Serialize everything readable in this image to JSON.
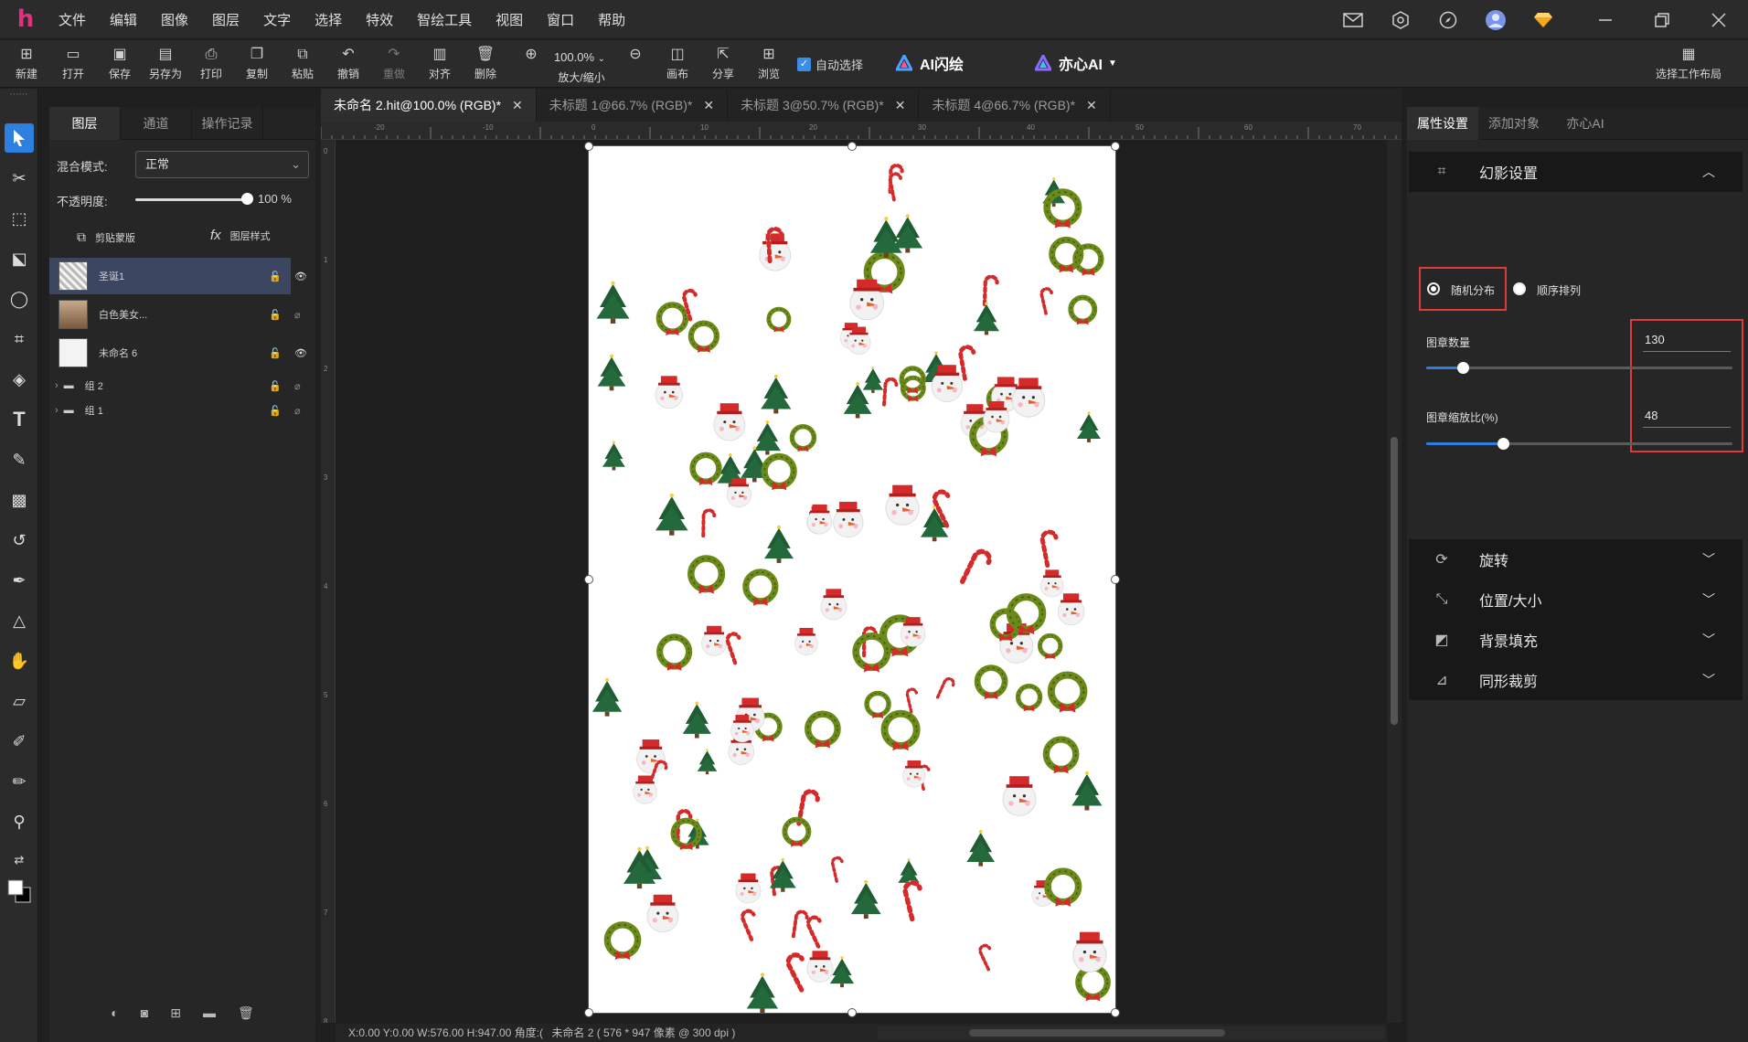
{
  "menu": [
    "文件",
    "编辑",
    "图像",
    "图层",
    "文字",
    "选择",
    "特效",
    "智绘工具",
    "视图",
    "窗口",
    "帮助"
  ],
  "toolbar": {
    "new": "新建",
    "open": "打开",
    "save": "保存",
    "save_as": "另存为",
    "print": "打印",
    "copy": "复制",
    "paste": "粘贴",
    "undo": "撤销",
    "redo": "重做",
    "align": "对齐",
    "delete": "删除",
    "zoom_value": "100.0%",
    "zoom_label": "放大/缩小",
    "canvas": "画布",
    "share": "分享",
    "browse": "浏览",
    "auto_select": "自动选择",
    "ai_flash": "AI闪绘",
    "yixin_ai": "亦心AI",
    "workspace_layout": "选择工作布局"
  },
  "layer_panel": {
    "tabs": [
      "图层",
      "通道",
      "操作记录"
    ],
    "blend_label": "混合模式:",
    "blend_value": "正常",
    "opacity_label": "不透明度:",
    "opacity_value": "100",
    "opacity_unit": "%",
    "opacity_level": 1.0,
    "clip_mask": "剪贴蒙版",
    "layer_style": "图层样式",
    "layers": [
      {
        "name": "圣诞1",
        "selected": true
      },
      {
        "name": "白色美女...",
        "selected": false
      },
      {
        "name": "未命名 6",
        "selected": false
      }
    ],
    "groups": [
      "组 2",
      "组 1"
    ]
  },
  "doc_tabs": [
    {
      "label": "未命名 2.hit@100.0% (RGB)*",
      "active": true
    },
    {
      "label": "未标题 1@66.7% (RGB)*",
      "active": false
    },
    {
      "label": "未标题 3@50.7% (RGB)*",
      "active": false
    },
    {
      "label": "未标题 4@66.7% (RGB)*",
      "active": false
    }
  ],
  "ruler_top": [
    "-20",
    "-10",
    "0",
    "10",
    "20",
    "30",
    "40",
    "50",
    "60",
    "70"
  ],
  "ruler_left": [
    "0",
    "1",
    "2",
    "3",
    "4",
    "5",
    "6",
    "7",
    "8"
  ],
  "status": {
    "coords": "X:0.00 Y:0.00 W:576.00 H:947.00 角度:(",
    "doc_info": "未命名 2 ( 576 * 947 像素 @ 300 dpi )"
  },
  "right_panel": {
    "tabs": [
      "属性设置",
      "添加对象",
      "亦心AI"
    ],
    "phantom_title": "幻影设置",
    "random_label": "随机分布",
    "sequential_label": "顺序排列",
    "count_label": "图章数量",
    "count_value": "130",
    "count_level": 0.12,
    "scale_label": "图章缩放比(%)",
    "scale_value": "48",
    "scale_level": 0.25,
    "sections": [
      "旋转",
      "位置/大小",
      "背景填充",
      "同形裁剪"
    ]
  },
  "colors": {
    "accent": "#2d7fe0",
    "highlight_box": "#e03b3b",
    "wreath": "#6b8a1a",
    "ribbon": "#d42a2a",
    "tree": "#1f5c34"
  }
}
